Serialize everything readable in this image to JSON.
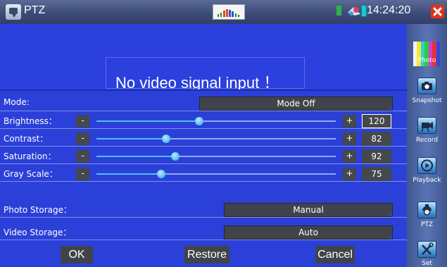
{
  "topbar": {
    "title": "PTZ",
    "time": "14:24:20",
    "icons": [
      "app-camera-icon",
      "signal-meter-icon",
      "sd-card-icon",
      "network-icon",
      "battery-icon",
      "close-icon"
    ]
  },
  "video": {
    "message": "No video signal input ！"
  },
  "settings": {
    "mode": {
      "label": "Mode:",
      "value": "Mode Off"
    },
    "brightness": {
      "label": "Brightness：",
      "minus": "-",
      "plus": "+",
      "value": "120",
      "level": 0.43
    },
    "contrast": {
      "label": "Contrast：",
      "minus": "-",
      "plus": "+",
      "value": "82",
      "level": 0.29
    },
    "saturation": {
      "label": "Saturation：",
      "minus": "-",
      "plus": "+",
      "value": "92",
      "level": 0.33
    },
    "grayscale": {
      "label": "Gray Scale：",
      "minus": "-",
      "plus": "+",
      "value": "75",
      "level": 0.27
    },
    "photo_storage": {
      "label": "Photo Storage：",
      "value": "Manual"
    },
    "video_storage": {
      "label": "Video Storage：",
      "value": "Auto"
    }
  },
  "buttons": {
    "ok": "OK",
    "restore": "Restore",
    "cancel": "Cancel"
  },
  "sidebar": {
    "items": [
      {
        "label": "Photo",
        "icon": "photo-color-bars-icon"
      },
      {
        "label": "Snapshot",
        "icon": "camera-icon"
      },
      {
        "label": "Record",
        "icon": "video-camera-icon"
      },
      {
        "label": "Playback",
        "icon": "play-icon"
      },
      {
        "label": "PTZ",
        "icon": "ptz-camera-icon"
      },
      {
        "label": "Set",
        "icon": "tools-icon"
      }
    ]
  },
  "colors": {
    "background": "#2b40d8",
    "button": "#40444a",
    "slider_fill": "#4cc0f0",
    "close": "#e23216"
  }
}
